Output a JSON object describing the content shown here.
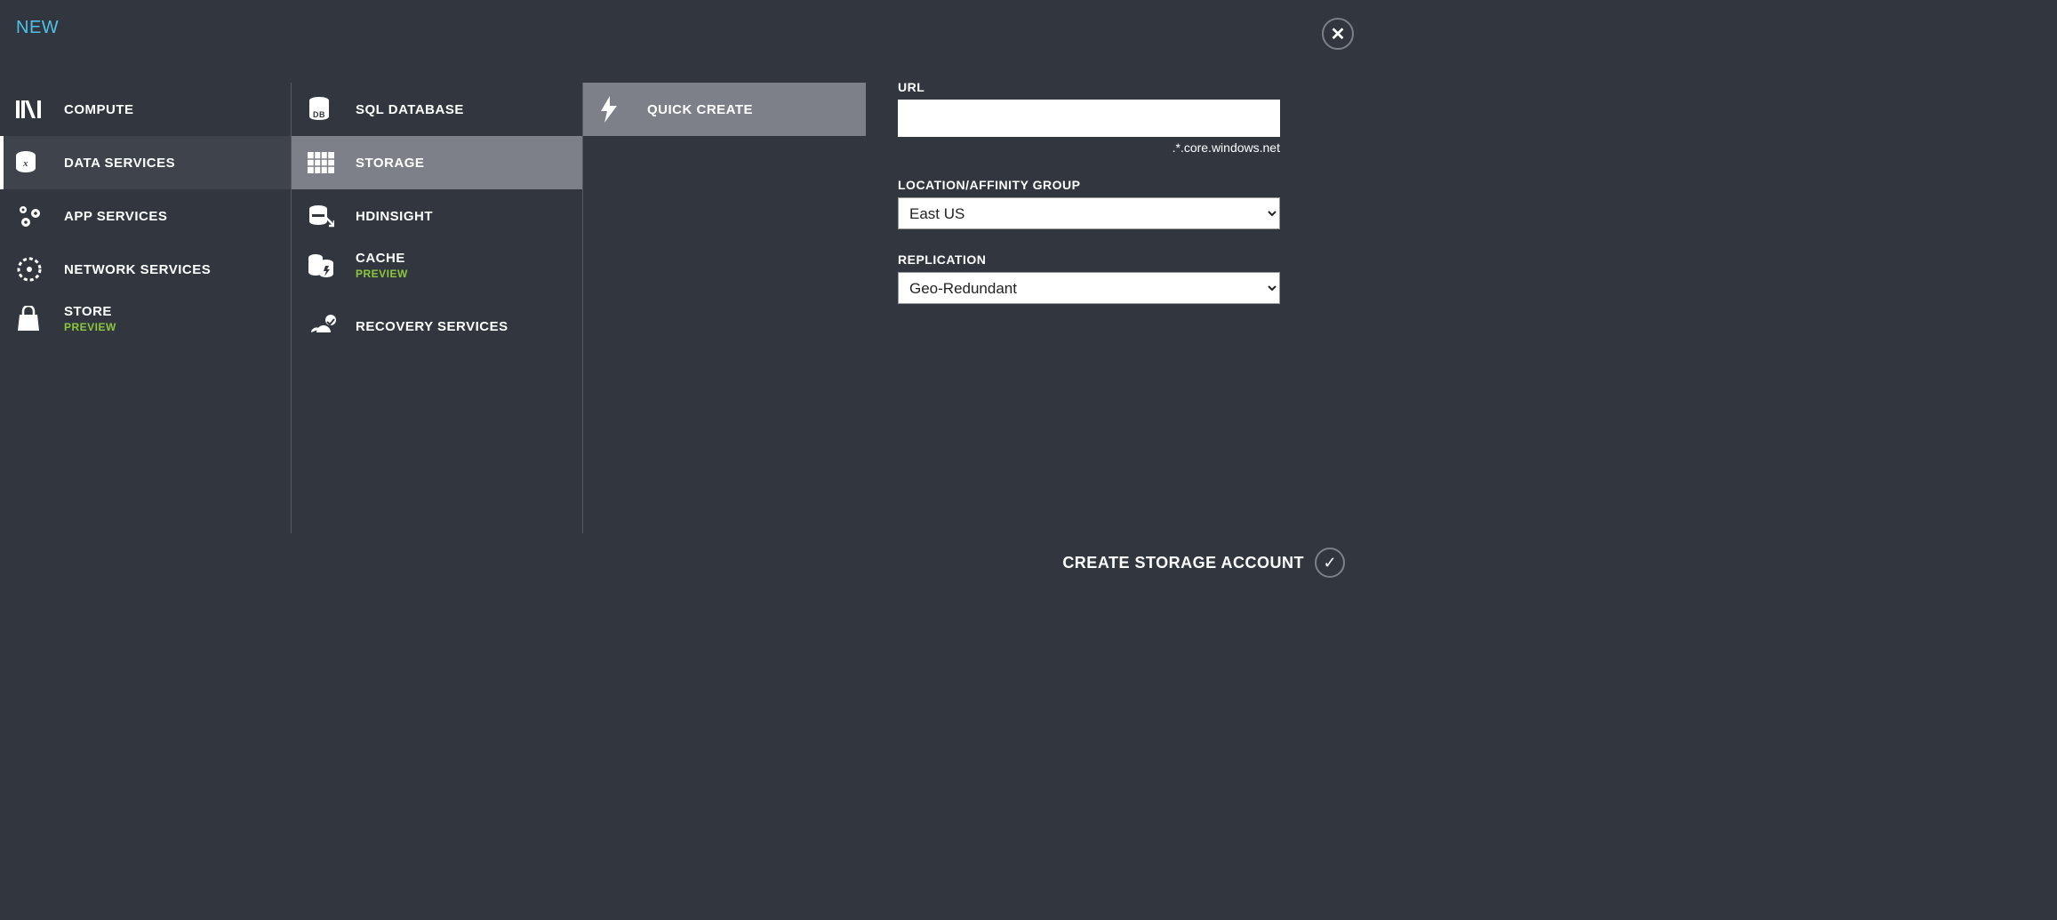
{
  "header": {
    "title": "NEW"
  },
  "column1": {
    "items": [
      {
        "label": "COMPUTE",
        "icon": "compute-icon"
      },
      {
        "label": "DATA SERVICES",
        "icon": "data-services-icon"
      },
      {
        "label": "APP SERVICES",
        "icon": "app-services-icon"
      },
      {
        "label": "NETWORK SERVICES",
        "icon": "network-services-icon"
      },
      {
        "label": "STORE",
        "preview": "PREVIEW",
        "icon": "store-icon"
      }
    ],
    "selected_index": 1
  },
  "column2": {
    "items": [
      {
        "label": "SQL DATABASE",
        "icon": "sql-database-icon"
      },
      {
        "label": "STORAGE",
        "icon": "storage-icon"
      },
      {
        "label": "HDINSIGHT",
        "icon": "hdinsight-icon"
      },
      {
        "label": "CACHE",
        "preview": "PREVIEW",
        "icon": "cache-icon"
      },
      {
        "label": "RECOVERY SERVICES",
        "icon": "recovery-services-icon"
      }
    ],
    "selected_index": 1
  },
  "column3": {
    "items": [
      {
        "label": "QUICK CREATE",
        "icon": "quick-create-icon"
      }
    ],
    "selected_index": 0
  },
  "form": {
    "url_label": "URL",
    "url_value": "",
    "url_suffix": ".*.core.windows.net",
    "location_label": "LOCATION/AFFINITY GROUP",
    "location_value": "East US",
    "replication_label": "REPLICATION",
    "replication_value": "Geo-Redundant"
  },
  "footer": {
    "create_label": "CREATE STORAGE ACCOUNT"
  }
}
